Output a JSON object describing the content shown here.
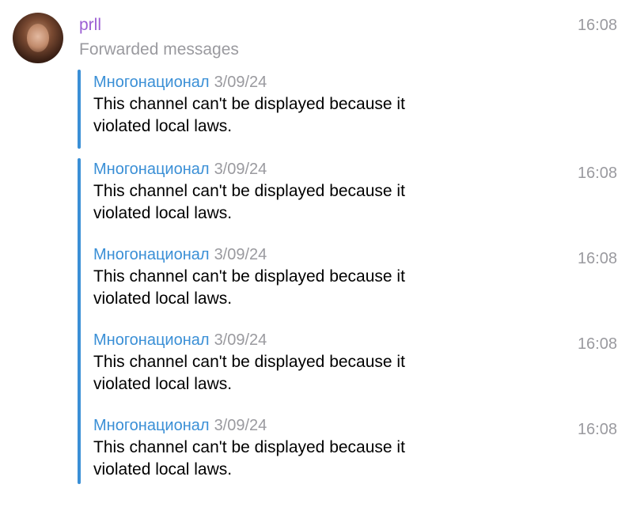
{
  "header": {
    "sender": "prll",
    "subtitle": "Forwarded messages",
    "time": "16:08"
  },
  "messages": [
    {
      "channel": "Многонационал",
      "date": "3/09/24",
      "text": "This channel can't be displayed because it violated local laws.",
      "time": ""
    },
    {
      "channel": "Многонационал",
      "date": "3/09/24",
      "text": "This channel can't be displayed because it violated local laws.",
      "time": "16:08"
    },
    {
      "channel": "Многонационал",
      "date": "3/09/24",
      "text": "This channel can't be displayed because it violated local laws.",
      "time": "16:08"
    },
    {
      "channel": "Многонационал",
      "date": "3/09/24",
      "text": "This channel can't be displayed because it violated local laws.",
      "time": "16:08"
    },
    {
      "channel": "Многонационал",
      "date": "3/09/24",
      "text": "This channel can't be displayed because it violated local laws.",
      "time": "16:08"
    }
  ],
  "colors": {
    "sender": "#9c5fd3",
    "accent": "#3a8fd6",
    "muted": "#9a9a9f"
  }
}
